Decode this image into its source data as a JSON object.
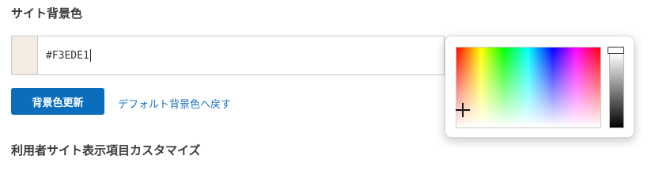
{
  "section_bg": {
    "title": "サイト背景色"
  },
  "color_field": {
    "value": "#F3EDE1",
    "swatch_color": "#F3EDE1"
  },
  "actions": {
    "update_button": "背景色更新",
    "reset_link": "デフォルト背景色へ戻す"
  },
  "section_custom": {
    "title": "利用者サイト表示項目カスタマイズ"
  },
  "colors": {
    "button": "#0a6ebd",
    "link": "#1a73c4",
    "title_text": "#3a3a3a"
  }
}
